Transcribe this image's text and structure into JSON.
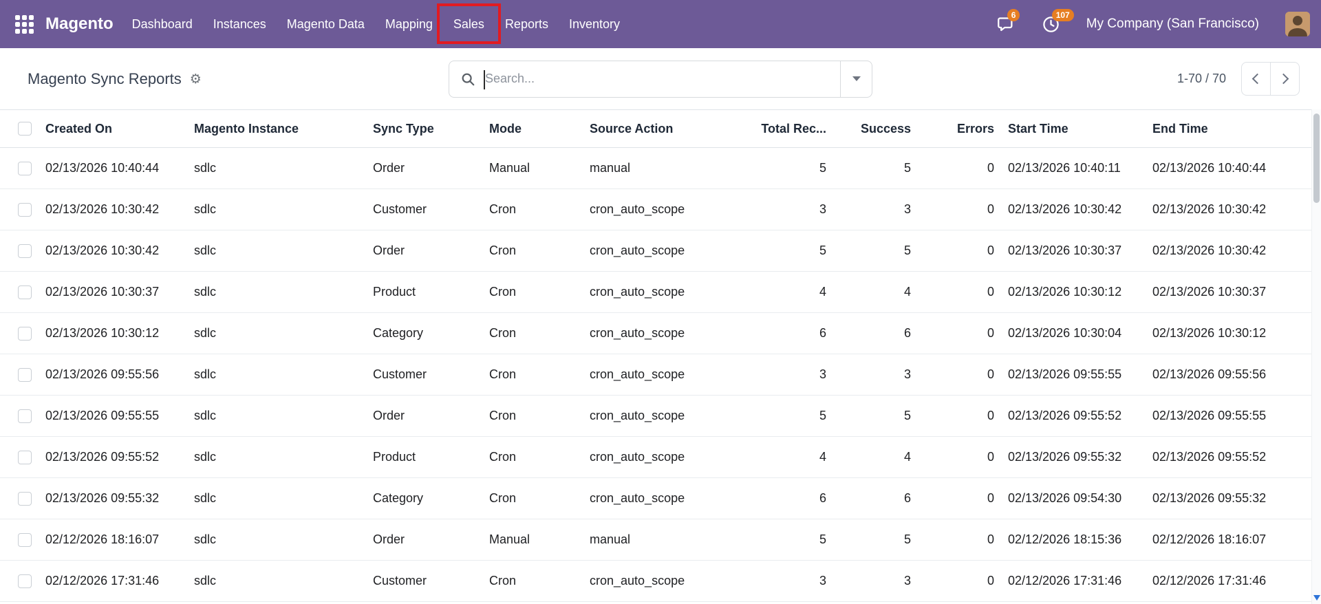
{
  "colors": {
    "navbar": "#6d5a97",
    "badge": "#e67e22",
    "annotation": "#e11b22"
  },
  "nav": {
    "brand": "Magento",
    "items": [
      "Dashboard",
      "Instances",
      "Magento Data",
      "Mapping",
      "Sales",
      "Reports",
      "Inventory"
    ],
    "annotated_item": "Sales",
    "message_badge": "6",
    "activity_badge": "107",
    "company": "My Company (San Francisco)"
  },
  "control_panel": {
    "title": "Magento Sync Reports",
    "search_placeholder": "Search...",
    "pager_text": "1-70 / 70"
  },
  "table": {
    "columns": [
      {
        "name": "created-on",
        "label": "Created On",
        "align": "left"
      },
      {
        "name": "magento-instance",
        "label": "Magento Instance",
        "align": "left"
      },
      {
        "name": "sync-type",
        "label": "Sync Type",
        "align": "left"
      },
      {
        "name": "mode",
        "label": "Mode",
        "align": "left"
      },
      {
        "name": "source-action",
        "label": "Source Action",
        "align": "left"
      },
      {
        "name": "total-records",
        "label": "Total Rec...",
        "align": "right"
      },
      {
        "name": "success",
        "label": "Success",
        "align": "right"
      },
      {
        "name": "errors",
        "label": "Errors",
        "align": "right"
      },
      {
        "name": "start-time",
        "label": "Start Time",
        "align": "left"
      },
      {
        "name": "end-time",
        "label": "End Time",
        "align": "left"
      }
    ],
    "rows": [
      [
        "02/13/2026 10:40:44",
        "sdlc",
        "Order",
        "Manual",
        "manual",
        "5",
        "5",
        "0",
        "02/13/2026 10:40:11",
        "02/13/2026 10:40:44"
      ],
      [
        "02/13/2026 10:30:42",
        "sdlc",
        "Customer",
        "Cron",
        "cron_auto_scope",
        "3",
        "3",
        "0",
        "02/13/2026 10:30:42",
        "02/13/2026 10:30:42"
      ],
      [
        "02/13/2026 10:30:42",
        "sdlc",
        "Order",
        "Cron",
        "cron_auto_scope",
        "5",
        "5",
        "0",
        "02/13/2026 10:30:37",
        "02/13/2026 10:30:42"
      ],
      [
        "02/13/2026 10:30:37",
        "sdlc",
        "Product",
        "Cron",
        "cron_auto_scope",
        "4",
        "4",
        "0",
        "02/13/2026 10:30:12",
        "02/13/2026 10:30:37"
      ],
      [
        "02/13/2026 10:30:12",
        "sdlc",
        "Category",
        "Cron",
        "cron_auto_scope",
        "6",
        "6",
        "0",
        "02/13/2026 10:30:04",
        "02/13/2026 10:30:12"
      ],
      [
        "02/13/2026 09:55:56",
        "sdlc",
        "Customer",
        "Cron",
        "cron_auto_scope",
        "3",
        "3",
        "0",
        "02/13/2026 09:55:55",
        "02/13/2026 09:55:56"
      ],
      [
        "02/13/2026 09:55:55",
        "sdlc",
        "Order",
        "Cron",
        "cron_auto_scope",
        "5",
        "5",
        "0",
        "02/13/2026 09:55:52",
        "02/13/2026 09:55:55"
      ],
      [
        "02/13/2026 09:55:52",
        "sdlc",
        "Product",
        "Cron",
        "cron_auto_scope",
        "4",
        "4",
        "0",
        "02/13/2026 09:55:32",
        "02/13/2026 09:55:52"
      ],
      [
        "02/13/2026 09:55:32",
        "sdlc",
        "Category",
        "Cron",
        "cron_auto_scope",
        "6",
        "6",
        "0",
        "02/13/2026 09:54:30",
        "02/13/2026 09:55:32"
      ],
      [
        "02/12/2026 18:16:07",
        "sdlc",
        "Order",
        "Manual",
        "manual",
        "5",
        "5",
        "0",
        "02/12/2026 18:15:36",
        "02/12/2026 18:16:07"
      ],
      [
        "02/12/2026 17:31:46",
        "sdlc",
        "Customer",
        "Cron",
        "cron_auto_scope",
        "3",
        "3",
        "0",
        "02/12/2026 17:31:46",
        "02/12/2026 17:31:46"
      ]
    ]
  }
}
